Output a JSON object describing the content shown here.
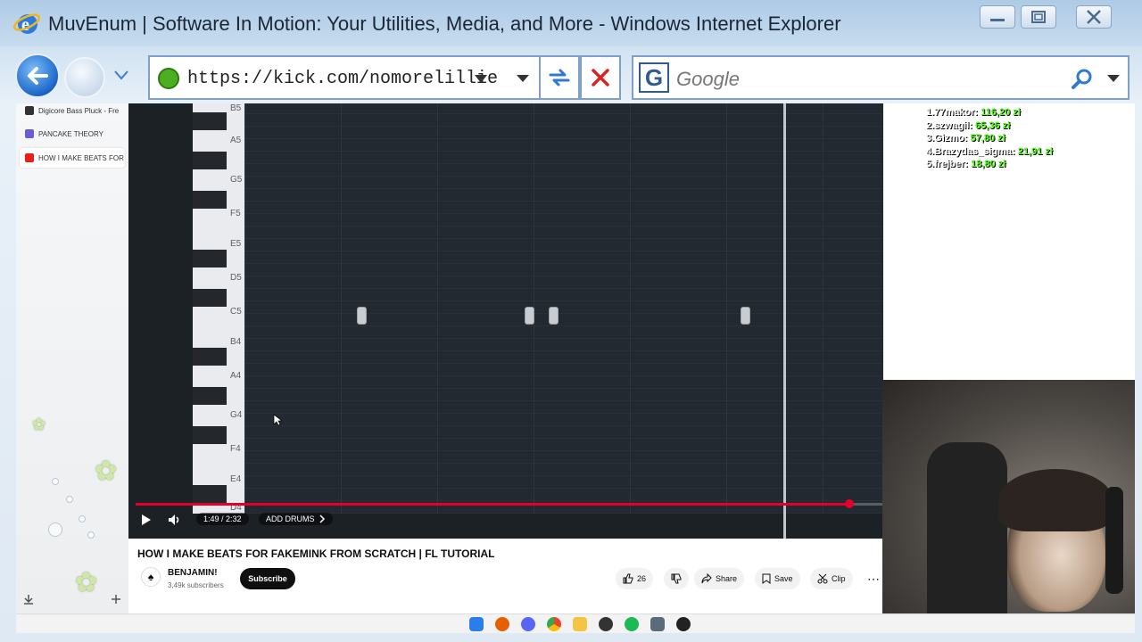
{
  "window": {
    "title": "MuvEnum | Software In Motion: Your Utilities, Media, and More - Windows Internet Explorer",
    "controls": [
      "minimize",
      "restore",
      "close"
    ]
  },
  "navbar": {
    "address": "https://kick.com/nomorelillie",
    "search_placeholder": "Google",
    "search_provider_letter": "G"
  },
  "sidebar": {
    "items": [
      {
        "label": "Digicore Bass Pluck - Fre",
        "icon": "digicore-icon",
        "color": "#333333"
      },
      {
        "label": "PANCAKE THEORY",
        "icon": "tab-icon",
        "color": "#6b5bd6"
      },
      {
        "label": "HOW I MAKE BEATS FOR",
        "icon": "youtube-icon",
        "color": "#e62117"
      }
    ]
  },
  "video": {
    "note_labels": [
      "B5",
      "A5",
      "G5",
      "F5",
      "E5",
      "D5",
      "C5",
      "B4",
      "A4",
      "G4",
      "F4",
      "E4",
      "D4"
    ],
    "note_chip_label": "C5",
    "time": "1:49 / 2:32",
    "chapter": "ADD DRUMS",
    "progress_fraction": 0.955
  },
  "meta": {
    "title": "HOW I MAKE BEATS FOR FAKEMINK FROM SCRATCH | FL TUTORIAL",
    "channel": "BENJAMIN!",
    "subscribers": "3,49k subscribers",
    "subscribe_label": "Subscribe",
    "likes": "26",
    "share_label": "Share",
    "save_label": "Save",
    "clip_label": "Clip"
  },
  "leaderboard": [
    {
      "rank_name": "1.77makor:",
      "amount": "116,20 zł"
    },
    {
      "rank_name": "2.szwagil:",
      "amount": "65,36 zł"
    },
    {
      "rank_name": "3.Gizmo:",
      "amount": "57,80 zł"
    },
    {
      "rank_name": "4.Brazydas_sigma:",
      "amount": "21,91 zł"
    },
    {
      "rank_name": "5.frejber:",
      "amount": "18,80 zł"
    }
  ],
  "taskbar": {
    "icons": [
      "windows-icon",
      "firefox-icon",
      "discord-icon",
      "chrome-icon",
      "folder-icon",
      "obs-icon",
      "spotify-icon",
      "calculator-icon",
      "app-icon"
    ]
  },
  "colors": {
    "accent": "#e4002b",
    "kick_green": "#53fc18"
  }
}
